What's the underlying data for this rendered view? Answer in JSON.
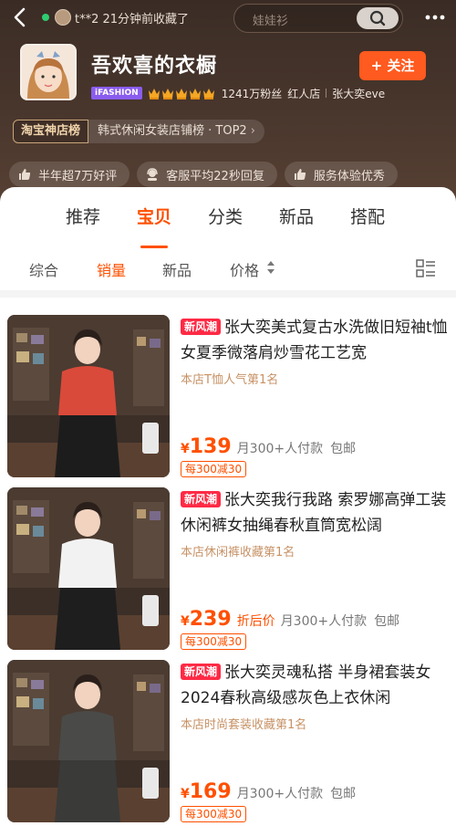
{
  "topbar": {
    "viewer_text": "t**2 21分钟前收藏了",
    "search_placeholder": "娃娃衫"
  },
  "shop": {
    "name": "吾欢喜的衣橱",
    "follow_label": "+ 关注",
    "ifashion_badge": "iFASHION",
    "crown_count": 5,
    "fans_text": "1241万粉丝",
    "shop_type": "红人店",
    "owner": "张大奕eve",
    "rank_badge": "淘宝神店榜",
    "rank_text": "韩式休闲女装店铺榜 · TOP2",
    "services": [
      {
        "label": "半年超7万好评",
        "icon": "thumbs-up-icon"
      },
      {
        "label": "客服平均22秒回复",
        "icon": "customer-service-icon"
      },
      {
        "label": "服务体验优秀",
        "icon": "thumbs-up-icon"
      }
    ]
  },
  "tabs": [
    {
      "label": "推荐",
      "active": false
    },
    {
      "label": "宝贝",
      "active": true
    },
    {
      "label": "分类",
      "active": false
    },
    {
      "label": "新品",
      "active": false
    },
    {
      "label": "搭配",
      "active": false
    }
  ],
  "sorts": [
    {
      "label": "综合",
      "active": false
    },
    {
      "label": "销量",
      "active": true
    },
    {
      "label": "新品",
      "active": false
    },
    {
      "label": "价格",
      "active": false
    }
  ],
  "products": [
    {
      "tag": "新风潮",
      "title": "张大奕美式复古水洗做旧短袖t恤女夏季微落肩炒雪花工艺宽",
      "rank_note": "本店T恤人气第1名",
      "currency": "¥",
      "price": "139",
      "after_discount": "",
      "sales": "月300+人付款",
      "shipping": "包邮",
      "coupon": "每300减30",
      "colors": {
        "top": "#d94a3a",
        "bottom": "#1c1c1c"
      }
    },
    {
      "tag": "新风潮",
      "title": "张大奕我行我路 索罗娜高弹工装休闲裤女抽绳春秋直筒宽松阔",
      "rank_note": "本店休闲裤收藏第1名",
      "currency": "¥",
      "price": "239",
      "after_discount": "折后价",
      "sales": "月300+人付款",
      "shipping": "包邮",
      "coupon": "每300减30",
      "colors": {
        "top": "#f2f2f2",
        "bottom": "#1e1e1e"
      }
    },
    {
      "tag": "新风潮",
      "title": "张大奕灵魂私搭 半身裙套装女2024春秋高级感灰色上衣休闲",
      "rank_note": "本店时尚套装收藏第1名",
      "currency": "¥",
      "price": "169",
      "after_discount": "",
      "sales": "月300+人付款",
      "shipping": "包邮",
      "coupon": "每300减30",
      "colors": {
        "top": "#4a4a48",
        "bottom": "#3a3a38"
      }
    }
  ],
  "colors": {
    "accent": "#ff5000",
    "header_bg": "#3a2c25",
    "new_tag": "#ff2a45",
    "follow": "#ff5a1f"
  }
}
